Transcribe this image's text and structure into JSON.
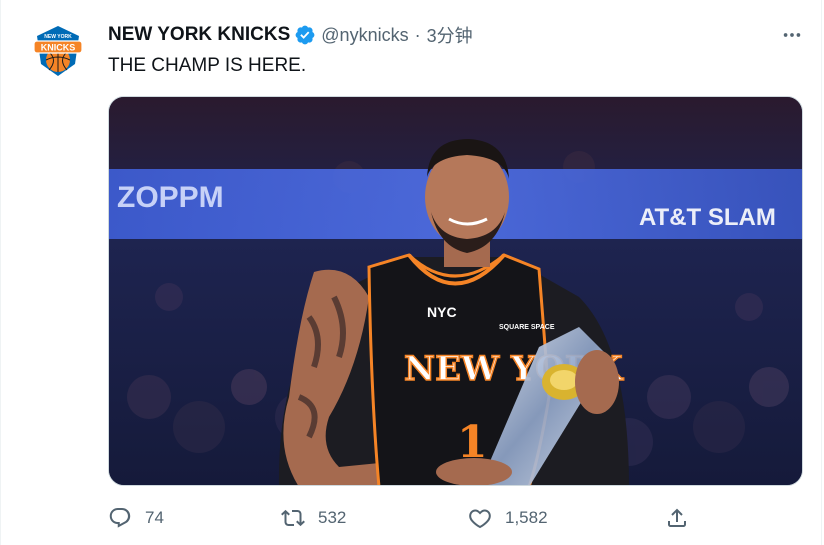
{
  "tweet": {
    "author_name": "NEW YORK KNICKS",
    "handle": "@nyknicks",
    "separator": "·",
    "time": "3分钟",
    "text": "THE CHAMP IS HERE.",
    "avatar": {
      "logo_text": "KNICKS",
      "logo_top": "NEW YORK"
    },
    "media": {
      "jersey_text": "NEW YORK",
      "jersey_number": "1",
      "chest_logo": "NYC",
      "sponsor": "SQUARE SPACE",
      "banner_left": "ZOPPM",
      "banner_right": "AT&T SLAM"
    },
    "reply_count": "74",
    "retweet_count": "532",
    "like_count": "1,582"
  },
  "colors": {
    "brand_blue": "#006bb6",
    "brand_orange": "#f58426",
    "verified": "#1d9bf0",
    "muted": "#536471"
  },
  "icons": [
    "knicks-logo",
    "verified-icon",
    "more-icon",
    "reply-icon",
    "retweet-icon",
    "like-icon",
    "share-icon"
  ]
}
